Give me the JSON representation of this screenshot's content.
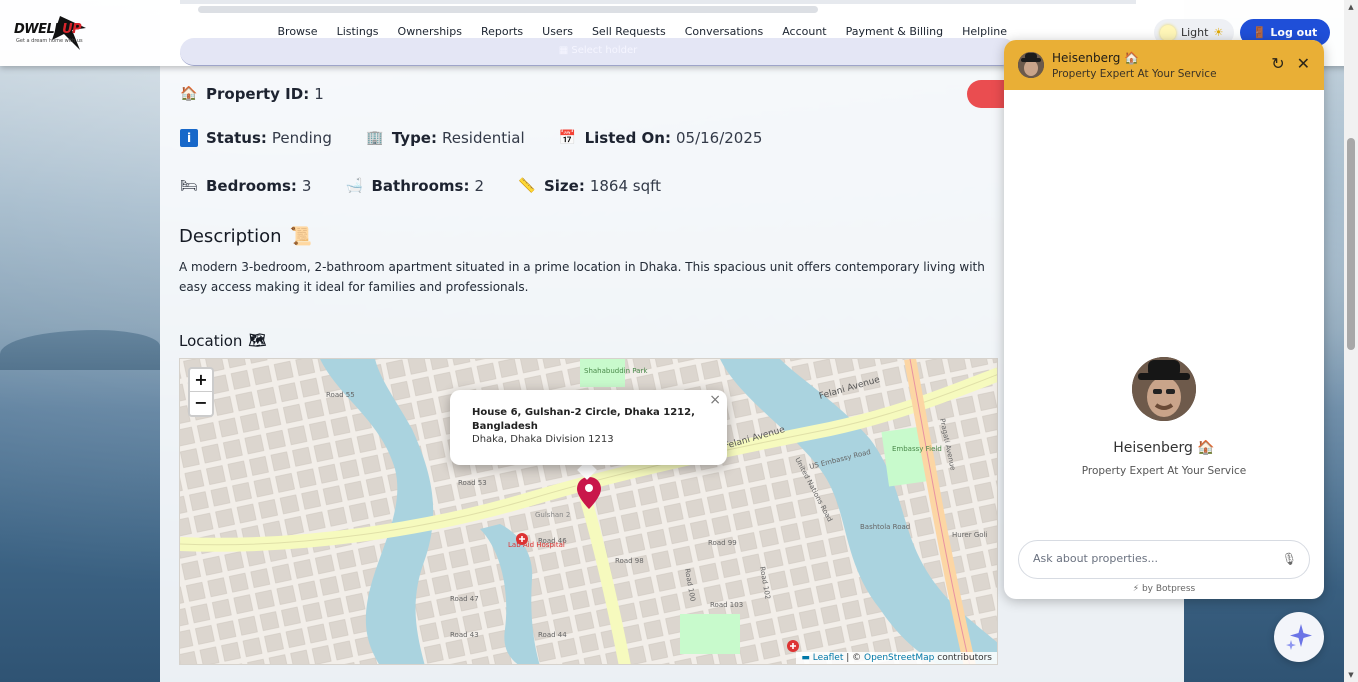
{
  "nav": {
    "logo_text_1": "DWELL",
    "logo_text_2": "UP",
    "logo_tagline": "Get a dream home with us",
    "links": [
      "Browse",
      "Listings",
      "Ownerships",
      "Reports",
      "Users",
      "Sell Requests",
      "Conversations",
      "Account",
      "Payment & Billing",
      "Helpline"
    ],
    "select_holder": "Select holder",
    "theme_label": "Light",
    "logout_label": "Log out"
  },
  "property": {
    "id_label": "Property ID:",
    "id_value": "1",
    "status_label": "Status:",
    "status_value": "Pending",
    "type_label": "Type:",
    "type_value": "Residential",
    "listed_label": "Listed On:",
    "listed_value": "05/16/2025",
    "bedrooms_label": "Bedrooms:",
    "bedrooms_value": "3",
    "bathrooms_label": "Bathrooms:",
    "bathrooms_value": "2",
    "size_label": "Size:",
    "size_value": "1864 sqft"
  },
  "description": {
    "title": "Description",
    "text": "A modern 3-bedroom, 2-bathroom apartment situated in a prime location in Dhaka. This spacious unit offers contemporary living with easy access making it ideal for families and professionals."
  },
  "location": {
    "title": "Location",
    "popup_line1": "House 6, Gulshan-2 Circle, Dhaka 1212, Bangladesh",
    "popup_line2": "Dhaka, Dhaka Division 1213",
    "zoom_in": "+",
    "zoom_out": "−",
    "attribution_leaflet": "Leaflet",
    "attribution_osm": "OpenStreetMap",
    "attribution_rest": "contributors",
    "map_labels": {
      "felani": "Felani Avenue",
      "felani2": "Felani Avenue",
      "road55": "Road 55",
      "road53": "Road 53",
      "road46": "Road 46",
      "road98": "Road 98",
      "road99": "Road 99",
      "road103": "Road 103",
      "road44": "Road 44",
      "road47": "Road 47",
      "road43": "Road 43",
      "road100": "Road 100",
      "road102": "Road 102",
      "labaid": "Lab Aid Hospital",
      "embassy": "Embassy Field",
      "usembassy": "US Embassy Road",
      "bashtola": "Bashtola Road",
      "hurergoli": "Hurer Goli",
      "pragati": "Pragati Avenue",
      "unitednations": "United Nations Road",
      "shahabuddin": "Shahabuddin Park",
      "gulshan": "Gulshan 2"
    }
  },
  "chat": {
    "bot_name": "Heisenberg",
    "bot_tagline": "Property Expert At Your Service",
    "input_placeholder": "Ask about properties...",
    "powered_by": "by Botpress"
  },
  "colors": {
    "chat_header": "#e9af36",
    "logout": "#1f4fd8",
    "accent_red": "#ea4d50"
  }
}
